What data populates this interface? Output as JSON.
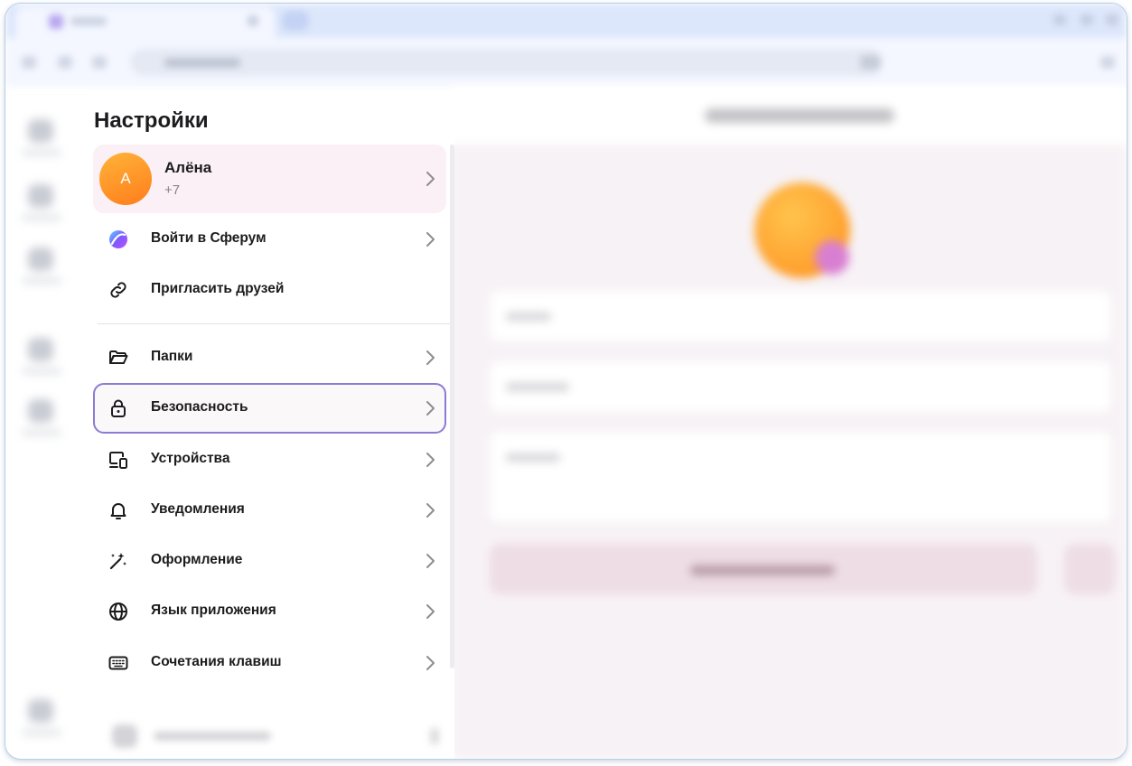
{
  "settings": {
    "title": "Настройки",
    "profile": {
      "avatar_letter": "А",
      "name": "Алёна",
      "phone": "+7"
    },
    "items": [
      {
        "id": "sferum",
        "label": "Войти в Сферум",
        "icon": "sferum-logo-icon",
        "chevron": true
      },
      {
        "id": "invite",
        "label": "Пригласить друзей",
        "icon": "link-icon",
        "chevron": false
      },
      {
        "id": "folders",
        "label": "Папки",
        "icon": "folder-icon",
        "chevron": true
      },
      {
        "id": "security",
        "label": "Безопасность",
        "icon": "lock-icon",
        "chevron": true,
        "selected": true
      },
      {
        "id": "devices",
        "label": "Устройства",
        "icon": "devices-icon",
        "chevron": true
      },
      {
        "id": "notifications",
        "label": "Уведомления",
        "icon": "bell-icon",
        "chevron": true
      },
      {
        "id": "appearance",
        "label": "Оформление",
        "icon": "magic-wand-icon",
        "chevron": true
      },
      {
        "id": "language",
        "label": "Язык приложения",
        "icon": "globe-icon",
        "chevron": true
      },
      {
        "id": "shortcuts",
        "label": "Сочетания клавиш",
        "icon": "keyboard-icon",
        "chevron": true
      }
    ]
  },
  "colors": {
    "accent_selected_border": "#8e7ad6",
    "profile_background": "#fbf0f5",
    "avatar_gradient_start": "#ffb338",
    "avatar_gradient_end": "#ff7d1c"
  }
}
